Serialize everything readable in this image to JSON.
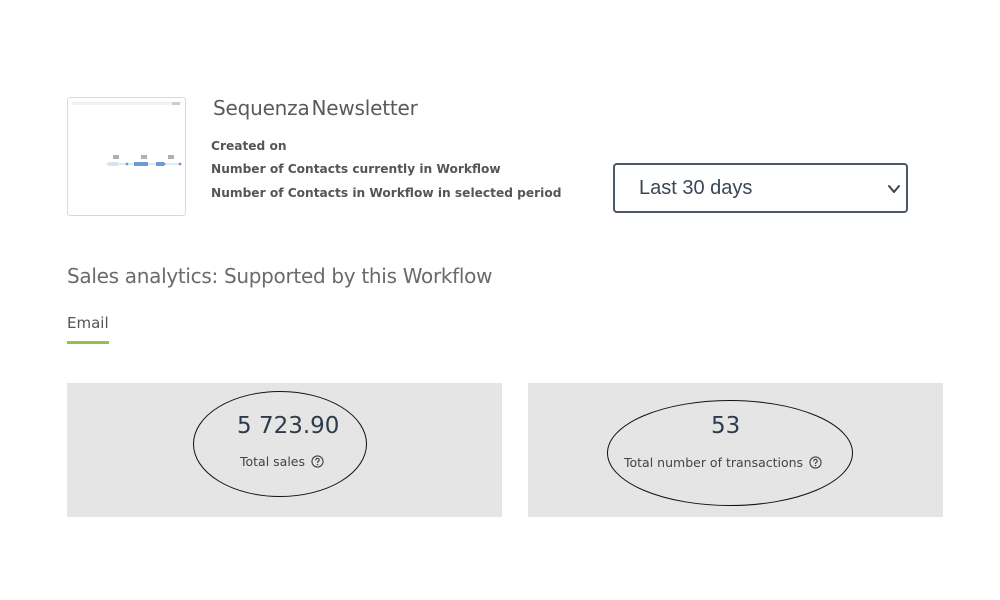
{
  "workflow": {
    "title_part1": "Sequenza",
    "title_part2": "Newsletter",
    "meta": [
      "Created on",
      "Number of Contacts currently in Workflow",
      "Number of Contacts in Workflow in selected period"
    ]
  },
  "period_select": {
    "selected": "Last 30 days"
  },
  "section": {
    "title": "Sales analytics: Supported by this Workflow"
  },
  "tabs": [
    {
      "label": "Email",
      "active": true,
      "accent": "#8dc34a"
    }
  ],
  "kpis": [
    {
      "value": "5 723.90",
      "label": "Total sales",
      "icon": "help-circle-icon"
    },
    {
      "value": "53",
      "label": "Total number of transactions",
      "icon": "help-circle-icon"
    }
  ],
  "colors": {
    "card_bg": "#e5e5e5",
    "accent": "#8dc34a",
    "select_border": "#4b5866"
  }
}
